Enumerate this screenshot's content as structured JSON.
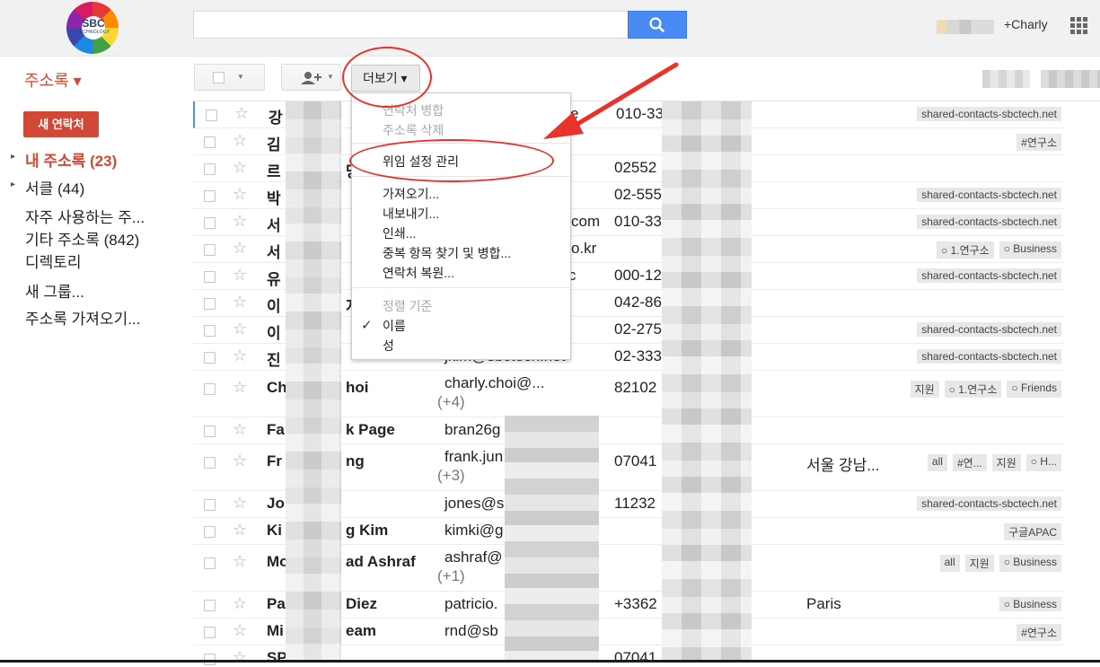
{
  "header": {
    "logo_text": "SBC",
    "logo_sub": "TECHNOLOGY",
    "search_placeholder": "",
    "account_label": "+Charly"
  },
  "nav": {
    "app_title": "주소록 ▾",
    "new_contact": "새 연락처",
    "items": [
      {
        "label": "내 주소록 (23)",
        "arrow": "▸"
      },
      {
        "label": "서클 (44)",
        "arrow": "▸"
      },
      {
        "label": "자주 사용하는 주..."
      },
      {
        "label": "기타 주소록 (842)"
      },
      {
        "label": "디렉토리"
      },
      {
        "label": "새 그룹..."
      },
      {
        "label": "주소록 가져오기..."
      }
    ]
  },
  "toolbar": {
    "more_label": "더보기 ▾"
  },
  "menu": {
    "merge": "연락처 병합",
    "delete": "주소록 삭제",
    "delegation": "위임 설정 관리",
    "import": "가져오기...",
    "export": "내보내기...",
    "print": "인쇄...",
    "find_dupes": "중복 항목 찾기 및 병합...",
    "restore": "연락처 복원...",
    "sort_header": "정렬 기준",
    "sort_first": "이름",
    "sort_last": "성",
    "checkmark": "✓"
  },
  "rows": [
    {
      "name": "강",
      "email": "",
      "email_tail": "e",
      "phone": "010-33",
      "labels": [
        "shared-contacts-sbctech.net"
      ]
    },
    {
      "name": "김",
      "email": "",
      "email_tail": "",
      "phone": "",
      "labels": [
        "#연구소"
      ]
    },
    {
      "name": "르",
      "name_tail": "당",
      "email": "",
      "phone": "02552",
      "labels": []
    },
    {
      "name": "박",
      "email": "",
      "phone": "02-555",
      "labels": [
        "shared-contacts-sbctech.net"
      ]
    },
    {
      "name": "서",
      "email": "",
      "email_tail": "com",
      "phone": "010-33",
      "labels": [
        "shared-contacts-sbctech.net"
      ]
    },
    {
      "name": "서",
      "email": "",
      "email_tail": "o.kr",
      "phone": "",
      "labels": [
        "○ 1.연구소",
        "○ Business"
      ]
    },
    {
      "name": "유",
      "email": "",
      "email_tail": "c",
      "phone": "000-12",
      "labels": [
        "shared-contacts-sbctech.net"
      ]
    },
    {
      "name": "이",
      "name_tail": "지",
      "email": "",
      "phone": "042-86",
      "phone_tail": ")",
      "labels": []
    },
    {
      "name": "이",
      "email": "",
      "phone": "02-275",
      "labels": [
        "shared-contacts-sbctech.net"
      ]
    },
    {
      "name": "진",
      "email": "jkim@sbctech.net",
      "phone": "02-333",
      "labels": [
        "shared-contacts-sbctech.net"
      ]
    },
    {
      "name": "Ch",
      "name_tail": "hoi",
      "email": "charly.choi@...",
      "extra": "(+4)",
      "phone": "82102",
      "labels": [
        "지원",
        "○ 1.연구소",
        "○ Friends"
      ]
    },
    {
      "name": "Fa",
      "name_tail": "k Page",
      "email": "bran26g",
      "phone": "",
      "labels": []
    },
    {
      "name": "Fr",
      "name_tail": "ng",
      "email": "frank.jun",
      "extra": "(+3)",
      "phone": "07041",
      "phone_tail": ")",
      "addr": "서울 강남...",
      "labels": [
        "all",
        "#연...",
        "지원",
        "○ H..."
      ]
    },
    {
      "name": "Jo",
      "email": "jones@s",
      "phone": "11232",
      "labels": [
        "shared-contacts-sbctech.net"
      ]
    },
    {
      "name": "Ki",
      "name_tail": "g Kim",
      "email": "kimki@g",
      "phone": "",
      "labels": [
        "구글APAC"
      ]
    },
    {
      "name": "Mo",
      "name_tail": "ad Ashraf",
      "email": "ashraf@",
      "extra": "(+1)",
      "phone": "",
      "labels": [
        "all",
        "지원",
        "○ Business"
      ]
    },
    {
      "name": "Pa",
      "name_tail": "Diez",
      "email": "patricio.",
      "phone": "+3362",
      "addr": "Paris",
      "labels": [
        "○ Business"
      ]
    },
    {
      "name": "Mi",
      "name_tail": "eam",
      "email": "rnd@sb",
      "phone": "",
      "labels": [
        "#연구소"
      ]
    },
    {
      "name": "SP",
      "email": "",
      "phone": "07041",
      "labels": []
    }
  ],
  "colors": {
    "accent_red": "#d14836",
    "search_blue": "#4a8af4",
    "annotation_red": "#e8322a"
  }
}
